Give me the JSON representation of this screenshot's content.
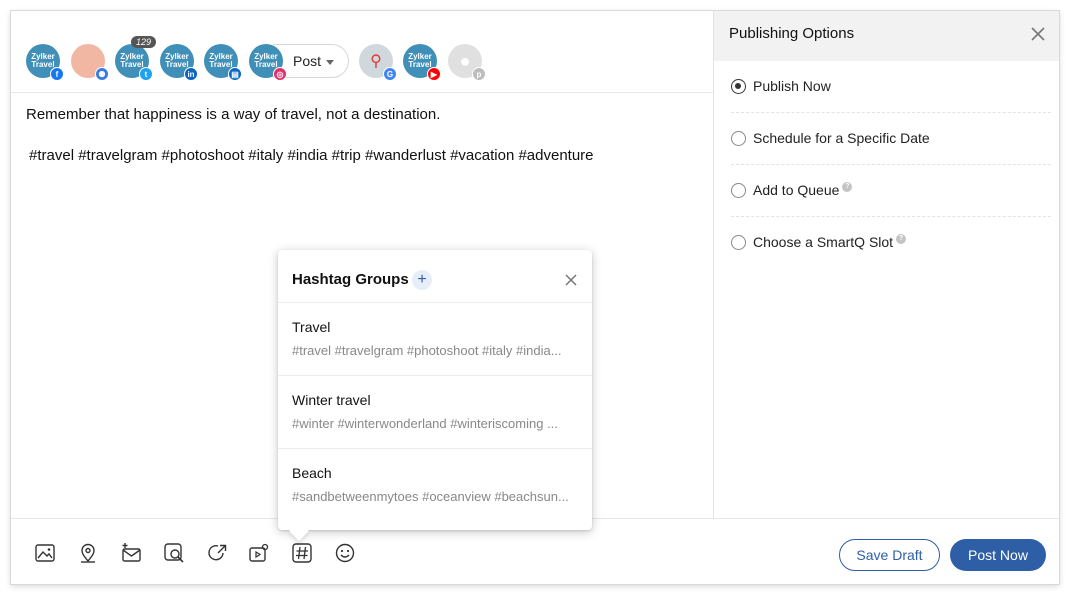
{
  "accounts": [
    {
      "name": "zylker-travel-facebook",
      "logo": "Zylker Travel",
      "network": "facebook",
      "network_color": "#1877f2"
    },
    {
      "name": "team-account",
      "logo": "",
      "network": "group",
      "network_color": "#3b7ddd"
    },
    {
      "name": "zylker-travel-twitter",
      "logo": "Zylker Travel",
      "network": "twitter",
      "network_color": "#1da1f2",
      "badge": "129"
    },
    {
      "name": "zylker-travel-linkedin",
      "logo": "Zylker Travel",
      "network": "linkedin",
      "network_color": "#0a66c2"
    },
    {
      "name": "zylker-travel-linkedin-page",
      "logo": "Zylker Travel",
      "network": "linkedin-page",
      "network_color": "#0a66c2"
    },
    {
      "name": "zylker-travel-instagram",
      "logo": "Zylker Travel",
      "network": "instagram",
      "network_color": "#e1306c"
    },
    {
      "name": "google-business",
      "logo": "",
      "network": "google",
      "network_color": "#4285f4"
    },
    {
      "name": "zylker-travel-youtube",
      "logo": "Zylker Travel",
      "network": "youtube",
      "network_color": "#ff0000"
    },
    {
      "name": "pinterest",
      "logo": "",
      "network": "pinterest",
      "network_color": "#bdbdbd"
    }
  ],
  "post_type": "Post",
  "composer": {
    "message": "Remember that happiness is a way of travel, not a destination.",
    "hashtags": "#travel #travelgram #photoshoot #italy #india #trip #wanderlust #vacation #adventure"
  },
  "publishing": {
    "title": "Publishing Options",
    "options": [
      {
        "label": "Publish Now",
        "selected": true,
        "help": false
      },
      {
        "label": "Schedule for a Specific Date",
        "selected": false,
        "help": false
      },
      {
        "label": "Add to Queue",
        "selected": false,
        "help": true
      },
      {
        "label": "Choose a SmartQ Slot",
        "selected": false,
        "help": true
      }
    ]
  },
  "hashtag_groups": {
    "title": "Hashtag Groups",
    "add_label": "+",
    "groups": [
      {
        "name": "Travel",
        "tags": "#travel #travelgram #photoshoot #italy #india..."
      },
      {
        "name": "Winter travel",
        "tags": "#winter #winterwonderland #winteriscoming ..."
      },
      {
        "name": "Beach",
        "tags": "#sandbetweenmytoes #oceanview #beachsun..."
      }
    ]
  },
  "toolbar": {
    "tools": [
      "image-icon",
      "location-icon",
      "add-message-icon",
      "search-media-icon",
      "share-icon",
      "video-settings-icon",
      "hashtag-icon",
      "emoji-icon"
    ],
    "save_draft": "Save Draft",
    "post_now": "Post Now"
  },
  "colors": {
    "primary": "#2e5ea5",
    "panel_header": "#f2f2f2"
  }
}
